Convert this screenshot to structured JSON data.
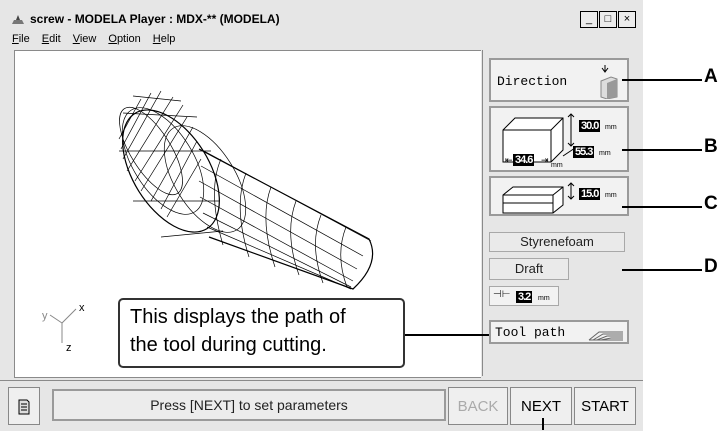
{
  "window": {
    "title": "screw - MODELA Player  : MDX-** (MODELA)",
    "controls": [
      "_",
      "□",
      "×"
    ]
  },
  "menu": [
    "File",
    "Edit",
    "View",
    "Option",
    "Help"
  ],
  "axes": {
    "x": "x",
    "y": "y",
    "z": "z"
  },
  "panel": {
    "direction_label": "Direction",
    "size_height": "30.0",
    "size_depth": "55.3",
    "size_width": "34.6",
    "size_unit": "mm",
    "depth_value": "15.0",
    "depth_unit": "mm",
    "material": "Styrenefoam",
    "quality": "Draft",
    "tool_value": "3.2",
    "tool_unit": "mm",
    "toolpath_label": "Tool path"
  },
  "note": {
    "line1": "This displays the path of",
    "line2": "the tool during cutting."
  },
  "status_text": "Press [NEXT] to set parameters",
  "buttons": {
    "back": "BACK",
    "next": "NEXT",
    "start": "START"
  },
  "callouts": [
    "A",
    "B",
    "C",
    "D"
  ]
}
